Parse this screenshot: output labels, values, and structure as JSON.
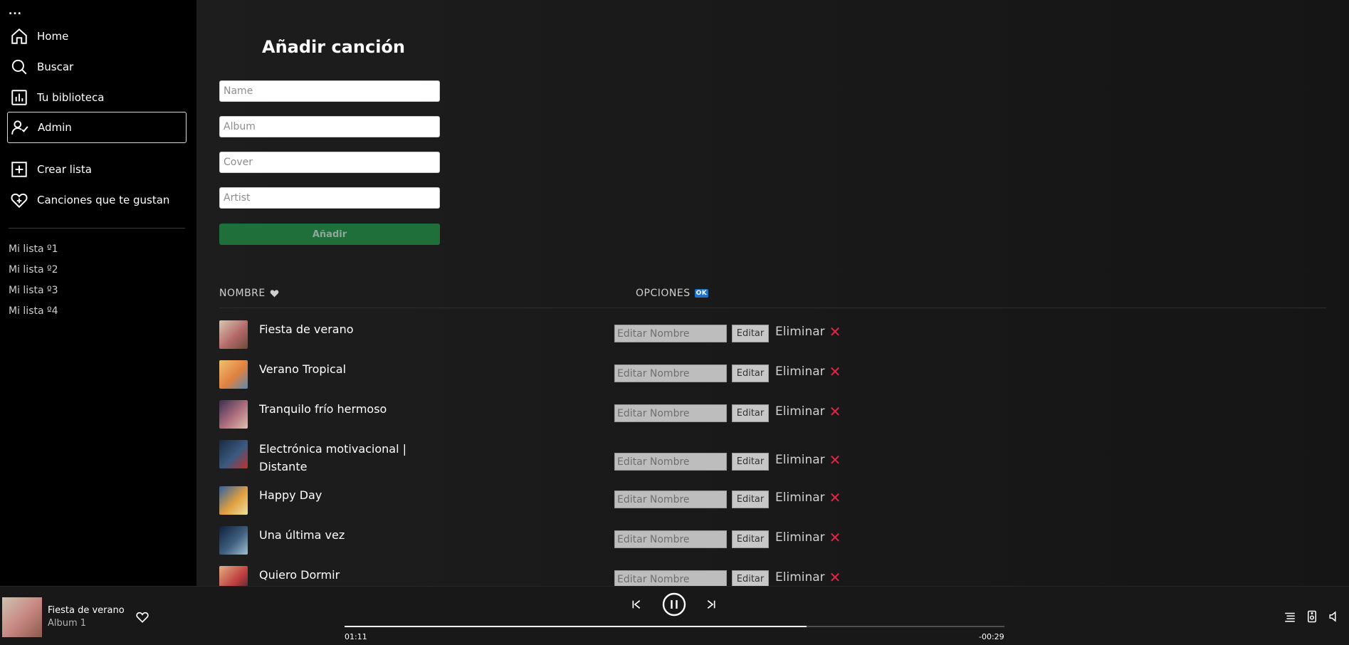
{
  "sidebar": {
    "menu_label": "...",
    "nav": [
      {
        "label": "Home",
        "icon": "home-icon"
      },
      {
        "label": "Buscar",
        "icon": "search-icon"
      },
      {
        "label": "Tu biblioteca",
        "icon": "library-icon"
      },
      {
        "label": "Admin",
        "icon": "admin-icon",
        "active": true
      }
    ],
    "actions": [
      {
        "label": "Crear lista",
        "icon": "plus-square-icon"
      },
      {
        "label": "Canciones que te gustan",
        "icon": "heart-plus-icon"
      }
    ],
    "playlists": [
      "Mi lista º1",
      "Mi lista º2",
      "Mi lista º3",
      "Mi lista º4"
    ]
  },
  "form": {
    "title": "Añadir canción",
    "fields": [
      {
        "placeholder": "Name"
      },
      {
        "placeholder": "Album"
      },
      {
        "placeholder": "Cover"
      },
      {
        "placeholder": "Artist"
      }
    ],
    "submit_label": "Añadir"
  },
  "table": {
    "col_name": "NOMBRE",
    "col_options": "OPCIONES",
    "ok_badge": "OK",
    "edit_placeholder": "Editar Nombre",
    "edit_label": "Editar",
    "delete_label": "Eliminar",
    "delete_icon": "✕",
    "songs": [
      {
        "title": "Fiesta de verano",
        "colors": [
          "#d8c7b0",
          "#b56a6a",
          "#6a4a3a"
        ]
      },
      {
        "title": "Verano Tropical",
        "colors": [
          "#f0c070",
          "#e08040",
          "#5a8ab0"
        ]
      },
      {
        "title": "Tranquilo frío hermoso",
        "colors": [
          "#3a3050",
          "#b07080",
          "#e0c0b0"
        ]
      },
      {
        "title": "Electrónica motivacional | Distante",
        "colors": [
          "#1a2a40",
          "#3a5a80",
          "#c03030"
        ]
      },
      {
        "title": "Happy Day",
        "colors": [
          "#3060a0",
          "#e0a040",
          "#f0e0a0"
        ]
      },
      {
        "title": "Una última vez",
        "colors": [
          "#10203a",
          "#406080",
          "#a0c0d0"
        ]
      },
      {
        "title": "Quiero Dormir",
        "colors": [
          "#e0b080",
          "#c04040",
          "#402030"
        ]
      }
    ]
  },
  "player": {
    "title": "Fiesta de verano",
    "album": "Album 1",
    "elapsed": "01:11",
    "remaining": "-00:29",
    "progress": 0.7
  },
  "colors": {
    "accent_green": "#1f6f3b",
    "delete_red": "#e0274a",
    "sidebar_bg": "#000000",
    "main_bg": "#181818"
  }
}
